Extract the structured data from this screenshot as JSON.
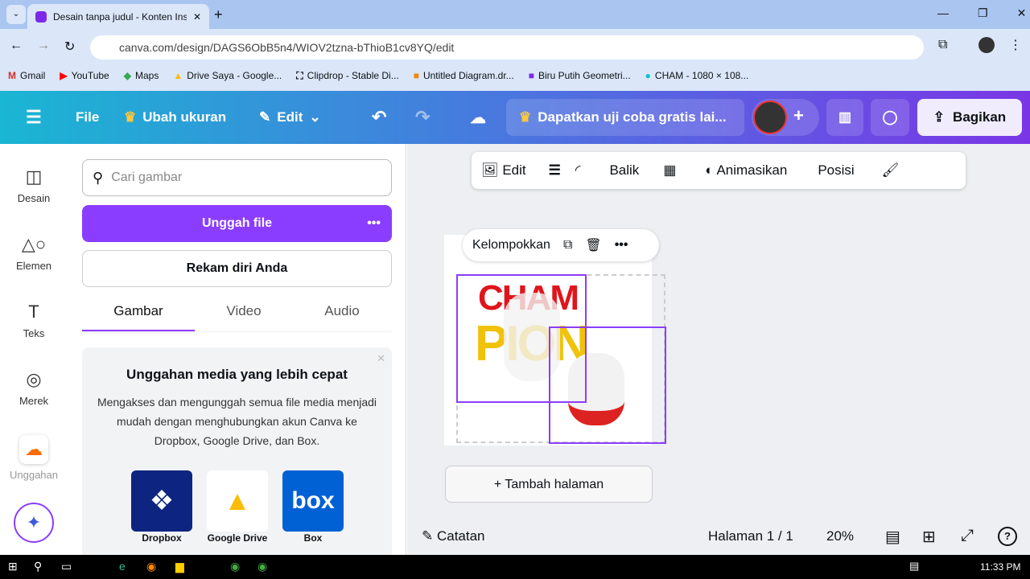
{
  "browser": {
    "tab_title": "Desain tanpa judul - Konten Ins",
    "url": "canva.com/design/DAGS6ObB5n4/WIOV2tzna-bThioB1cv8YQ/edit",
    "bookmarks": [
      "Gmail",
      "YouTube",
      "Maps",
      "Drive Saya - Google...",
      "Clipdrop - Stable Di...",
      "Untitled Diagram.dr...",
      "Biru Putih Geometri...",
      "CHAM - 1080 × 108..."
    ]
  },
  "header": {
    "file": "File",
    "resize": "Ubah ukuran",
    "edit": "Edit",
    "trial": "Dapatkan uji coba gratis lai...",
    "share": "Bagikan"
  },
  "rail": [
    "Desain",
    "Elemen",
    "Teks",
    "Merek",
    "Unggahan"
  ],
  "panel": {
    "search_placeholder": "Cari gambar",
    "upload": "Unggah file",
    "record": "Rekam diri Anda",
    "tabs": [
      "Gambar",
      "Video",
      "Audio"
    ],
    "promo_title": "Unggahan media yang lebih cepat",
    "promo_text": "Mengakses dan mengunggah semua file media menjadi mudah dengan menghubungkan akun Canva ke Dropbox, Google Drive, dan Box.",
    "services": [
      "Dropbox",
      "Google Drive",
      "Box"
    ]
  },
  "toolbar": {
    "edit": "Edit",
    "flip": "Balik",
    "animate": "Animasikan",
    "position": "Posisi"
  },
  "context": {
    "group": "Kelompokkan"
  },
  "design": {
    "word1": "CHAM",
    "word2": "PION"
  },
  "footer": {
    "add_page": "+ Tambah halaman",
    "notes": "Catatan",
    "page": "Halaman 1 / 1",
    "zoom": "20%"
  },
  "taskbar": {
    "time": "11:33 PM"
  },
  "colors": {
    "accent": "#8b3dff",
    "red": "#e0151b",
    "yellow": "#f0c20a"
  }
}
